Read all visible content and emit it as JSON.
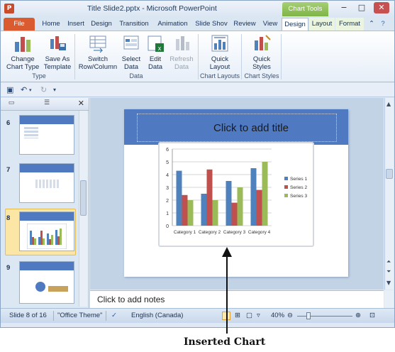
{
  "titlebar": {
    "app_icon": "P",
    "title": "Title Slide2.pptx - Microsoft PowerPoint",
    "context_tab": "Chart Tools",
    "qat_icons": [
      "save-icon",
      "undo-icon",
      "redo-icon",
      "customize-icon"
    ],
    "window_controls": [
      "−",
      "□",
      "✕"
    ]
  },
  "tabs": [
    {
      "label": "File"
    },
    {
      "label": "Home"
    },
    {
      "label": "Insert"
    },
    {
      "label": "Design"
    },
    {
      "label": "Transition"
    },
    {
      "label": "Animation"
    },
    {
      "label": "Slide Shov"
    },
    {
      "label": "Review"
    },
    {
      "label": "View"
    },
    {
      "label": "Design"
    },
    {
      "label": "Layout"
    },
    {
      "label": "Format"
    }
  ],
  "ribbon": {
    "change_chart_type": "Change\nChart Type",
    "save_as_template": "Save As\nTemplate",
    "switch_row_col": "Switch\nRow/Column",
    "select_data": "Select\nData",
    "edit_data": "Edit\nData",
    "refresh_data": "Refresh\nData",
    "quick_layout": "Quick\nLayout",
    "quick_styles": "Quick\nStyles",
    "groups": {
      "type": "Type",
      "data": "Data",
      "chart_layouts": "Chart Layouts",
      "chart_styles": "Chart Styles"
    }
  },
  "slides_pane": {
    "items": [
      {
        "number": "6"
      },
      {
        "number": "7"
      },
      {
        "number": "8",
        "selected": true
      },
      {
        "number": "9"
      }
    ]
  },
  "slide": {
    "title_placeholder": "Click to add title"
  },
  "chart_data": {
    "type": "bar",
    "categories": [
      "Category 1",
      "Category 2",
      "Category 3",
      "Category 4"
    ],
    "series": [
      {
        "name": "Series 1",
        "values": [
          4.3,
          2.5,
          3.5,
          4.5
        ],
        "color": "#4f81bd"
      },
      {
        "name": "Series 2",
        "values": [
          2.4,
          4.4,
          1.8,
          2.8
        ],
        "color": "#c0504d"
      },
      {
        "name": "Series 3",
        "values": [
          2,
          2,
          3,
          5
        ],
        "color": "#9bbb59"
      }
    ],
    "ylim": [
      0,
      6
    ],
    "yticks": [
      "0",
      "1",
      "2",
      "3",
      "4",
      "5",
      "6"
    ],
    "grid": true,
    "legend": "right"
  },
  "notes": {
    "placeholder": "Click to add notes"
  },
  "status": {
    "slide_info": "Slide 8 of 16",
    "theme": "\"Office Theme\"",
    "language": "English (Canada)",
    "zoom": "40%"
  },
  "caption": "Inserted Chart"
}
